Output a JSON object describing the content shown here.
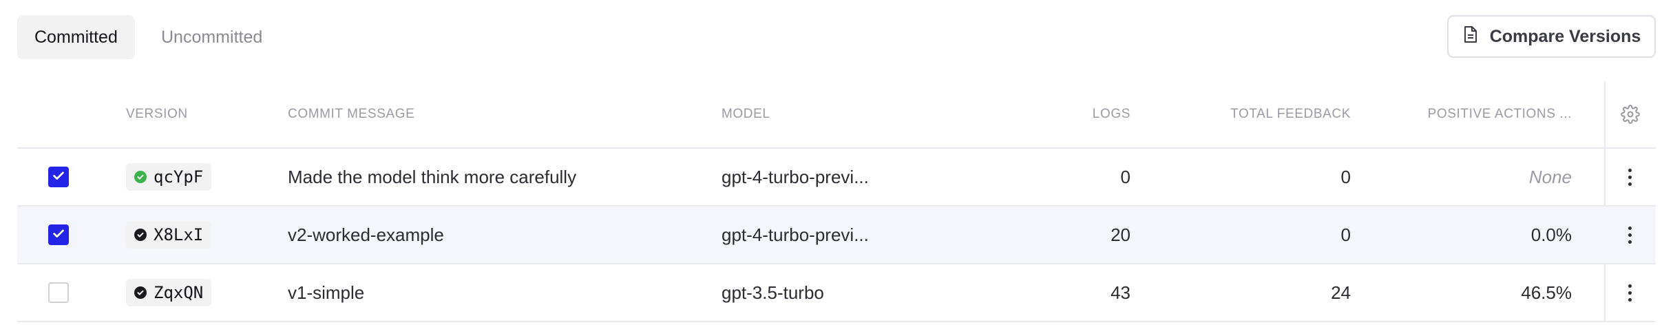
{
  "tabs": {
    "committed": "Committed",
    "uncommitted": "Uncommitted"
  },
  "compare_button": {
    "label": "Compare Versions",
    "icon": "document-icon"
  },
  "table": {
    "headers": {
      "version": "VERSION",
      "commit_message": "COMMIT MESSAGE",
      "model": "MODEL",
      "logs": "LOGS",
      "total_feedback": "TOTAL FEEDBACK",
      "positive_actions": "POSITIVE ACTIONS ..."
    },
    "settings_icon": "gear-icon",
    "rows": [
      {
        "checked": true,
        "status": "deployed",
        "status_color": "#3cb24a",
        "version": "qcYpF",
        "commit_message": "Made the model think more carefully",
        "model": "gpt-4-turbo-previ...",
        "logs": "0",
        "total_feedback": "0",
        "positive_actions": "None"
      },
      {
        "checked": true,
        "status": "committed",
        "status_color": "#1a1a1f",
        "version": "X8LxI",
        "commit_message": "v2-worked-example",
        "model": "gpt-4-turbo-previ...",
        "logs": "20",
        "total_feedback": "0",
        "positive_actions": "0.0%"
      },
      {
        "checked": false,
        "status": "committed",
        "status_color": "#1a1a1f",
        "version": "ZqxQN",
        "commit_message": "v1-simple",
        "model": "gpt-3.5-turbo",
        "logs": "43",
        "total_feedback": "24",
        "positive_actions": "46.5%"
      }
    ]
  },
  "colors": {
    "checkbox_accent": "#2424e6",
    "selected_row": "#f4f6fc"
  }
}
